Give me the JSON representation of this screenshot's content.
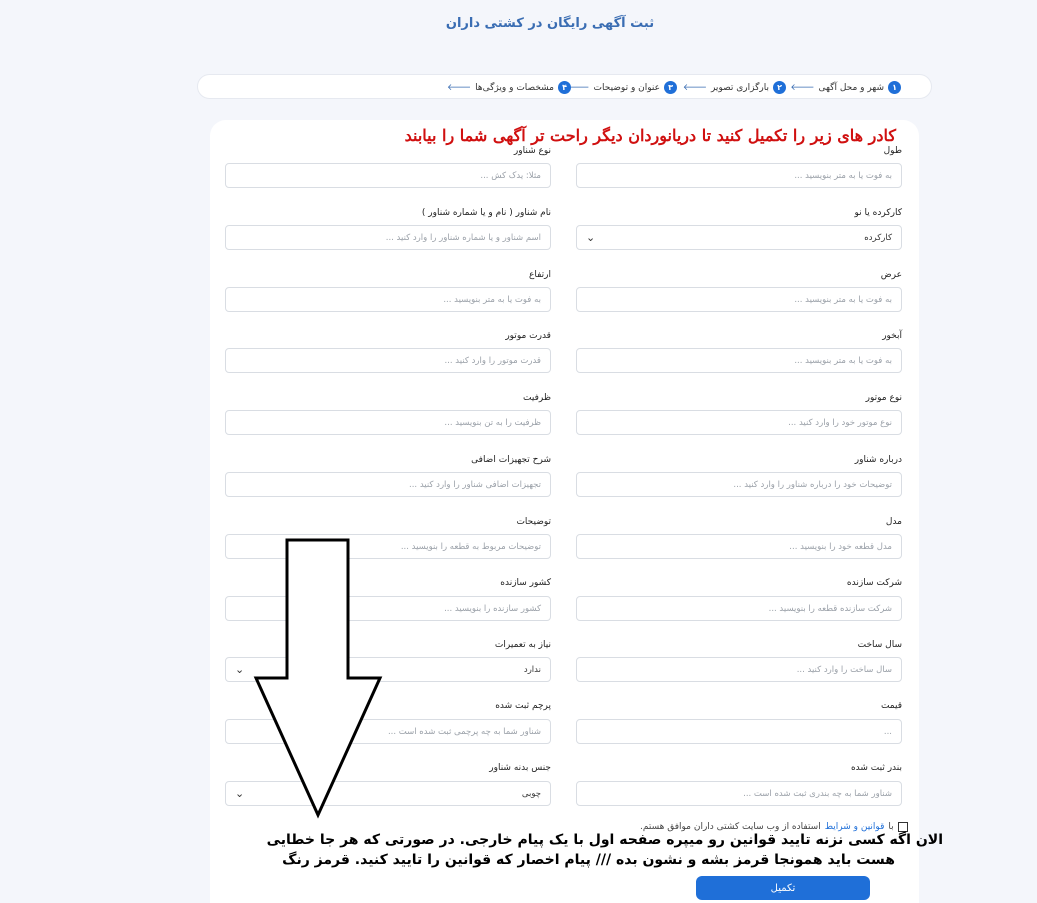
{
  "page_title": "ثبت آگهی رایگان در کشتی داران",
  "steps": [
    {
      "num": "۱",
      "label": "شهر و محل آگهی"
    },
    {
      "num": "۲",
      "label": "بارگزاری تصویر"
    },
    {
      "num": "۳",
      "label": "عنوان و توضیحات"
    },
    {
      "num": "۴",
      "label": "مشخصات و ویژگی‌ها"
    }
  ],
  "notice": "کادر های زیر را تکمیل کنید تا دریانوردان دیگر راحت تر آگهی شما را بیابند",
  "right_col": [
    {
      "label": "طول",
      "placeholder": "به فوت یا به متر بنویسید ..."
    },
    {
      "label": "کارکرده یا نو",
      "value": "کارکرده"
    },
    {
      "label": "عرض",
      "placeholder": "به فوت یا به متر بنویسید ..."
    },
    {
      "label": "آبخور",
      "placeholder": "به فوت یا به متر بنویسید ..."
    },
    {
      "label": "نوع موتور",
      "placeholder": "نوع موتور خود را وارد کنید ..."
    },
    {
      "label": "درباره شناور",
      "placeholder": "توضیحات خود را درباره شناور را وارد کنید ..."
    },
    {
      "label": "مدل",
      "placeholder": "مدل قطعه خود را بنویسید ..."
    },
    {
      "label": "شرکت سازنده",
      "placeholder": "شرکت سازنده قطعه را بنویسید ..."
    },
    {
      "label": "سال ساخت",
      "placeholder": "سال ساخت را وارد کنید ..."
    },
    {
      "label": "قیمت",
      "placeholder": "..."
    },
    {
      "label": "بندر ثبت شده",
      "placeholder": "شناور شما به چه بندری ثبت شده است ..."
    }
  ],
  "left_col": [
    {
      "label": "نوع شناور",
      "placeholder": "مثلا: یدک کش ..."
    },
    {
      "label": "نام شناور ( نام و یا شماره شناور )",
      "placeholder": "اسم شناور و یا شماره شناور را وارد کنید ..."
    },
    {
      "label": "ارتفاع",
      "placeholder": "به فوت یا به متر بنویسید ..."
    },
    {
      "label": "قدرت موتور",
      "placeholder": "قدرت موتور را وارد کنید ..."
    },
    {
      "label": "ظرفیت",
      "placeholder": "ظرفیت را به تن بنویسید ..."
    },
    {
      "label": "شرح تجهیزات اضافی",
      "placeholder": "تجهیزات اضافی شناور را وارد کنید ..."
    },
    {
      "label": "توضیحات",
      "placeholder": "توضیحات مربوط به قطعه را بنویسید ..."
    },
    {
      "label": "کشور سازنده",
      "placeholder": "کشور سازنده را بنویسید ..."
    },
    {
      "label": "نیاز به تعمیرات",
      "value": "ندارد"
    },
    {
      "label": "پرچم ثبت شده",
      "placeholder": "شناور شما به چه پرچمی ثبت شده است ..."
    },
    {
      "label": "جنس بدنه شناور",
      "value": "چوبی"
    }
  ],
  "terms": {
    "prefix": "با",
    "link": "قوانین و شرایط",
    "suffix": "استفاده از وب سایت کشتی داران  موافق هستم."
  },
  "annotation": {
    "line1": "الان اگه کسی نزنه تایید قوانین رو میپره صفحه اول با یک پیام خارجی. در صورتی که هر جا خطایی",
    "line2": "هست باید همونجا قرمز بشه و نشون بده /// پیام اخصار که قوانین را تایید کنید. قرمز رنگ"
  },
  "submit_label": "تکمیل"
}
